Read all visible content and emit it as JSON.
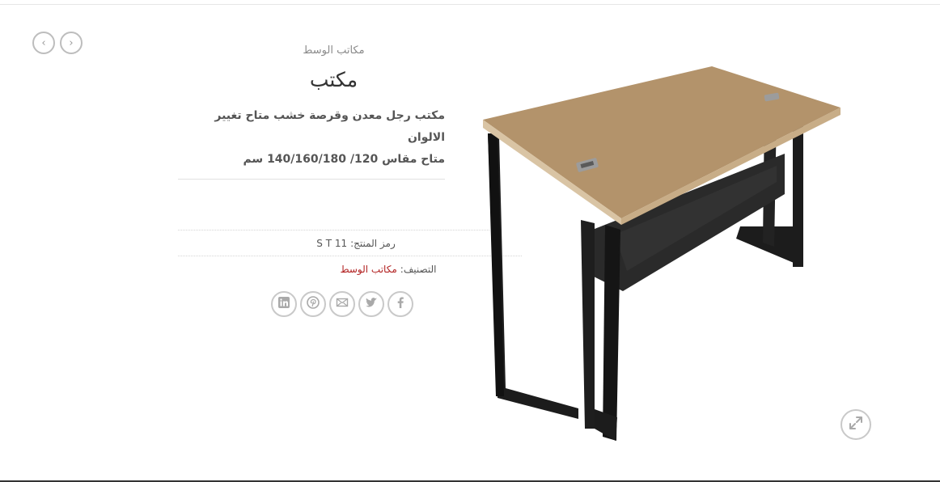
{
  "nav": {
    "prev_glyph": "‹",
    "next_glyph": "›",
    "prev_icon": "chevron-left-icon",
    "next_icon": "chevron-right-icon"
  },
  "product": {
    "breadcrumb": "مكاتب الوسط",
    "title": "مكتب",
    "description_line1": "مكتب  رجل معدن وقرصة خشب متاح تغيير الالوان",
    "description_line2": "متاح مقاس 120/ 140/160/180 سم",
    "sku_label": "رمز المنتج:",
    "sku_value": "S T 11",
    "category_label": "التصنيف:",
    "category_value": "مكاتب الوسط"
  },
  "share": [
    {
      "icon": "linkedin-icon"
    },
    {
      "icon": "pinterest-icon"
    },
    {
      "icon": "email-icon"
    },
    {
      "icon": "twitter-icon"
    },
    {
      "icon": "facebook-icon"
    }
  ],
  "colors": {
    "link": "#b22222",
    "icon_border": "#c9c9c9",
    "desk_top": "#b3936b",
    "desk_frame": "#1e1e1e"
  }
}
